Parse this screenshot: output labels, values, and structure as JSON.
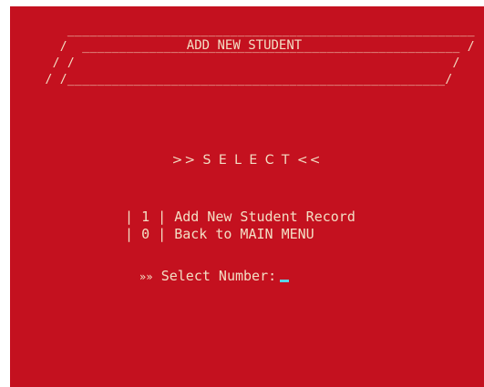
{
  "colors": {
    "background": "#c4111f",
    "text": "#f3dec4",
    "cursor": "#5ad3e6"
  },
  "header": {
    "title": "ADD NEW STUDENT"
  },
  "select_heading": ">> S E L E C T <<",
  "menu": {
    "items": [
      {
        "key": "1",
        "label": "Add New Student Record"
      },
      {
        "key": "0",
        "label": "Back to MAIN MENU"
      }
    ]
  },
  "prompt": {
    "arrows": "»»",
    "label": "Select Number:",
    "value": ""
  }
}
